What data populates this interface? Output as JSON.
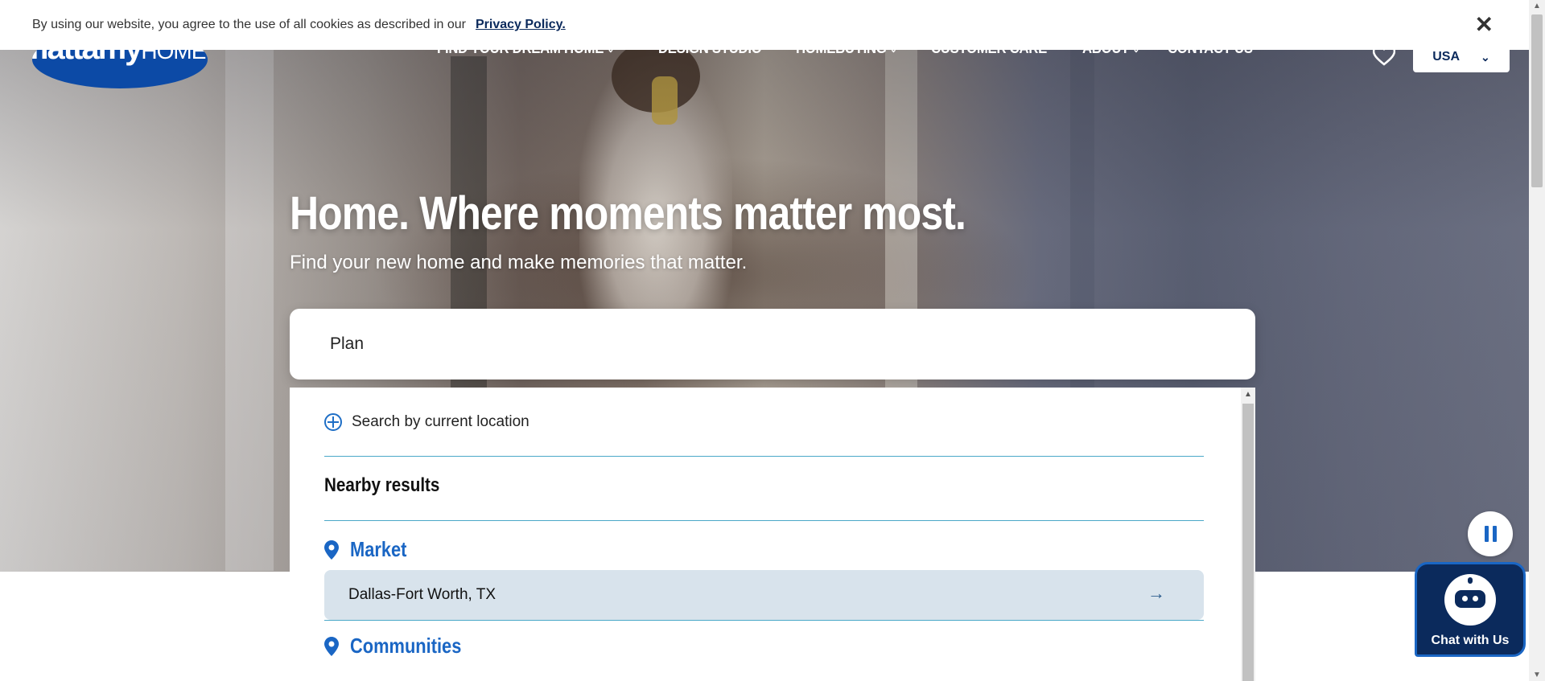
{
  "cookie_bar": {
    "message": "By using our website, you agree to the use of all cookies as described in our",
    "link_text": "Privacy Policy.",
    "close_symbol": "✕"
  },
  "header": {
    "logo_text": "mattamy",
    "logo_suffix": "HOMES",
    "nav": [
      {
        "label": "FIND YOUR DREAM HOME",
        "has_dropdown": true
      },
      {
        "label": "DESIGN STUDIO",
        "has_dropdown": false
      },
      {
        "label": "HOMEBUYING",
        "has_dropdown": true
      },
      {
        "label": "CUSTOMER CARE",
        "has_dropdown": false
      },
      {
        "label": "ABOUT",
        "has_dropdown": true
      },
      {
        "label": "CONTACT US",
        "has_dropdown": false
      }
    ],
    "favorites_icon": "heart-icon",
    "country": "USA"
  },
  "hero": {
    "headline": "Home. Where moments matter most.",
    "subheadline": "Find your new home and make memories that matter."
  },
  "search": {
    "value": "Plan",
    "current_location_label": "Search by current location",
    "nearby_heading": "Nearby results",
    "categories": [
      {
        "label": "Market",
        "results": [
          "Dallas-Fort Worth, TX"
        ]
      },
      {
        "label": "Communities",
        "results": []
      }
    ]
  },
  "chat": {
    "label": "Chat with Us"
  },
  "colors": {
    "brand_blue": "#1a66c4",
    "navy": "#0b2a5c",
    "highlight_row": "#d8e3ec",
    "divider": "#4aa8c8"
  }
}
